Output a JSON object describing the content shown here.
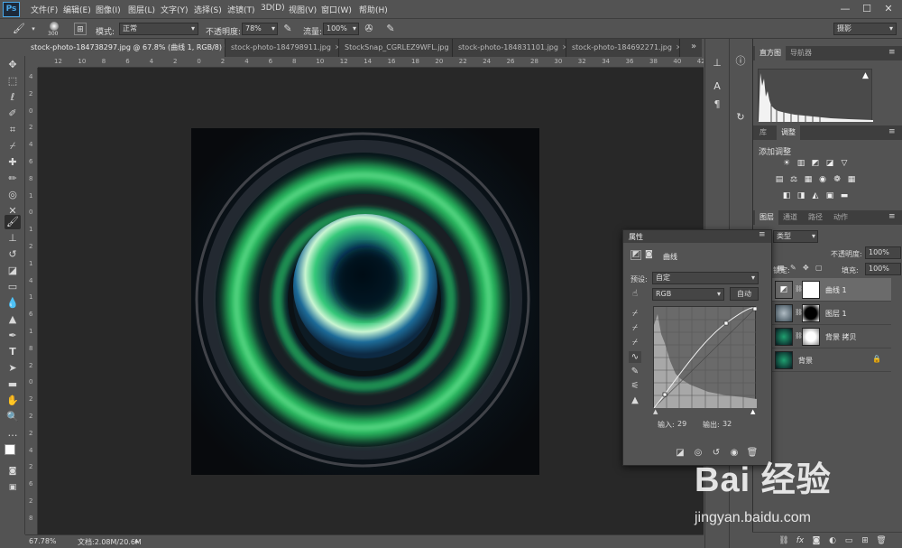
{
  "app": {
    "logo": "Ps",
    "workspace": "摄影"
  },
  "menu": [
    "文件(F)",
    "编辑(E)",
    "图像(I)",
    "图层(L)",
    "文字(Y)",
    "选择(S)",
    "滤镜(T)",
    "3D(D)",
    "视图(V)",
    "窗口(W)",
    "帮助(H)"
  ],
  "window_controls": {
    "minimize": "—",
    "maximize": "☐",
    "close": "✕"
  },
  "options": {
    "brush_size": "300",
    "mode_label": "模式:",
    "mode_value": "正常",
    "opacity_label": "不透明度:",
    "opacity_value": "78%",
    "flow_label": "流量:",
    "flow_value": "100%"
  },
  "tabs": [
    {
      "label": "stock-photo-184738297.jpg @ 67.8% (曲线 1, RGB/8) *",
      "active": true
    },
    {
      "label": "stock-photo-184798911.jpg",
      "active": false
    },
    {
      "label": "StockSnap_CGRLEZ9WFL.jpg",
      "active": false
    },
    {
      "label": "stock-photo-184831101.jpg",
      "active": false
    },
    {
      "label": "stock-photo-184692271.jpg",
      "active": false
    }
  ],
  "tab_overflow": "»",
  "ruler_top_labels": [
    "12",
    "10",
    "8",
    "6",
    "4",
    "2",
    "0",
    "2",
    "4",
    "6",
    "8",
    "10",
    "12",
    "14",
    "16",
    "18",
    "20",
    "22",
    "24",
    "26",
    "28",
    "30",
    "32",
    "34",
    "36",
    "38",
    "40",
    "42"
  ],
  "ruler_left_labels": [
    "4",
    "2",
    "0",
    "2",
    "4",
    "6",
    "8",
    "1",
    "0",
    "1",
    "2",
    "1",
    "4",
    "1",
    "6",
    "1",
    "8",
    "2",
    "0",
    "2",
    "2",
    "2",
    "4",
    "2",
    "6",
    "2",
    "8"
  ],
  "status": {
    "zoom": "67.78%",
    "doc": "文档:2.08M/20.6M"
  },
  "panels": {
    "histogram_tab": "直方图",
    "navigator_tab": "导航器",
    "library_tab": "库",
    "adjust_tab": "调整",
    "add_adjust_label": "添加调整",
    "layers_tab": "图层",
    "channels_tab": "通道",
    "paths_tab": "路径",
    "actions_tab": "动作",
    "kind_filter": "类型",
    "opacity_label": "不透明度:",
    "opacity_value": "100%",
    "fill_label": "填充:",
    "fill_value": "100%",
    "lock_label": "锁定:"
  },
  "layers": [
    {
      "name": "曲线 1",
      "selected": true,
      "type": "curves",
      "colors": [
        "#7a7a7a",
        "#ffffff"
      ]
    },
    {
      "name": "图层 1",
      "selected": false,
      "type": "pixel",
      "colors": [
        "#5a7080",
        "#111111"
      ]
    },
    {
      "name": "背景 拷贝",
      "selected": false,
      "type": "pixel",
      "colors": [
        "#1a6070",
        "#dddddd"
      ]
    },
    {
      "name": "背景",
      "selected": false,
      "type": "background",
      "colors": [
        "#1a6070"
      ],
      "lock": "🔒"
    }
  ],
  "properties": {
    "title": "属性",
    "type_label": "曲线",
    "preset_label": "预设:",
    "preset_value": "自定",
    "channel_value": "RGB",
    "auto_label": "自动",
    "input_label": "输入:",
    "input_value": "29",
    "output_label": "输出:",
    "output_value": "32"
  },
  "watermark": {
    "brand": "Bai 经验",
    "url": "jingyan.baidu.com"
  },
  "colors": {
    "fg": "#ffffff",
    "bg": "#000000",
    "accent": "#4aa8e8",
    "aurora": "#2fd56a"
  }
}
